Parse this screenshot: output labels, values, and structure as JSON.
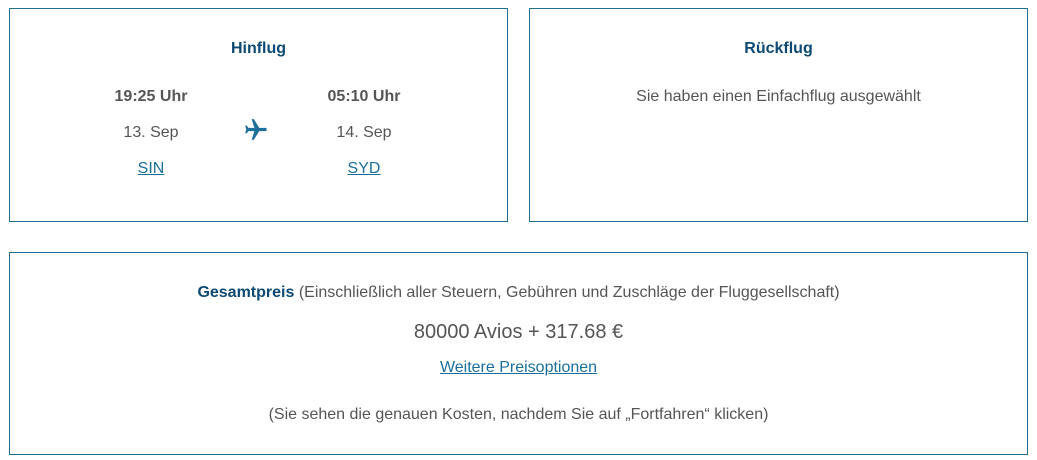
{
  "outbound": {
    "title": "Hinflug",
    "departure": {
      "time": "19:25 Uhr",
      "date": "13. Sep",
      "airport": "SIN"
    },
    "arrival": {
      "time": "05:10 Uhr",
      "date": "14. Sep",
      "airport": "SYD"
    },
    "icon": "airplane-icon"
  },
  "return": {
    "title": "Rückflug",
    "message": "Sie haben einen Einfachflug ausgewählt"
  },
  "total": {
    "label": "Gesamtpreis",
    "label_note": "(Einschließlich aller Steuern, Gebühren und Zuschläge der Fluggesellschaft)",
    "amount": "80000 Avios + 317.68 €",
    "more_options": "Weitere Preisoptionen",
    "note": "(Sie sehen die genauen Kosten, nachdem Sie auf „Fortfahren“ klicken)"
  },
  "colors": {
    "border": "#1f6f8f",
    "heading": "#0d4a73",
    "link": "#1a6f9a",
    "text": "#555555"
  }
}
